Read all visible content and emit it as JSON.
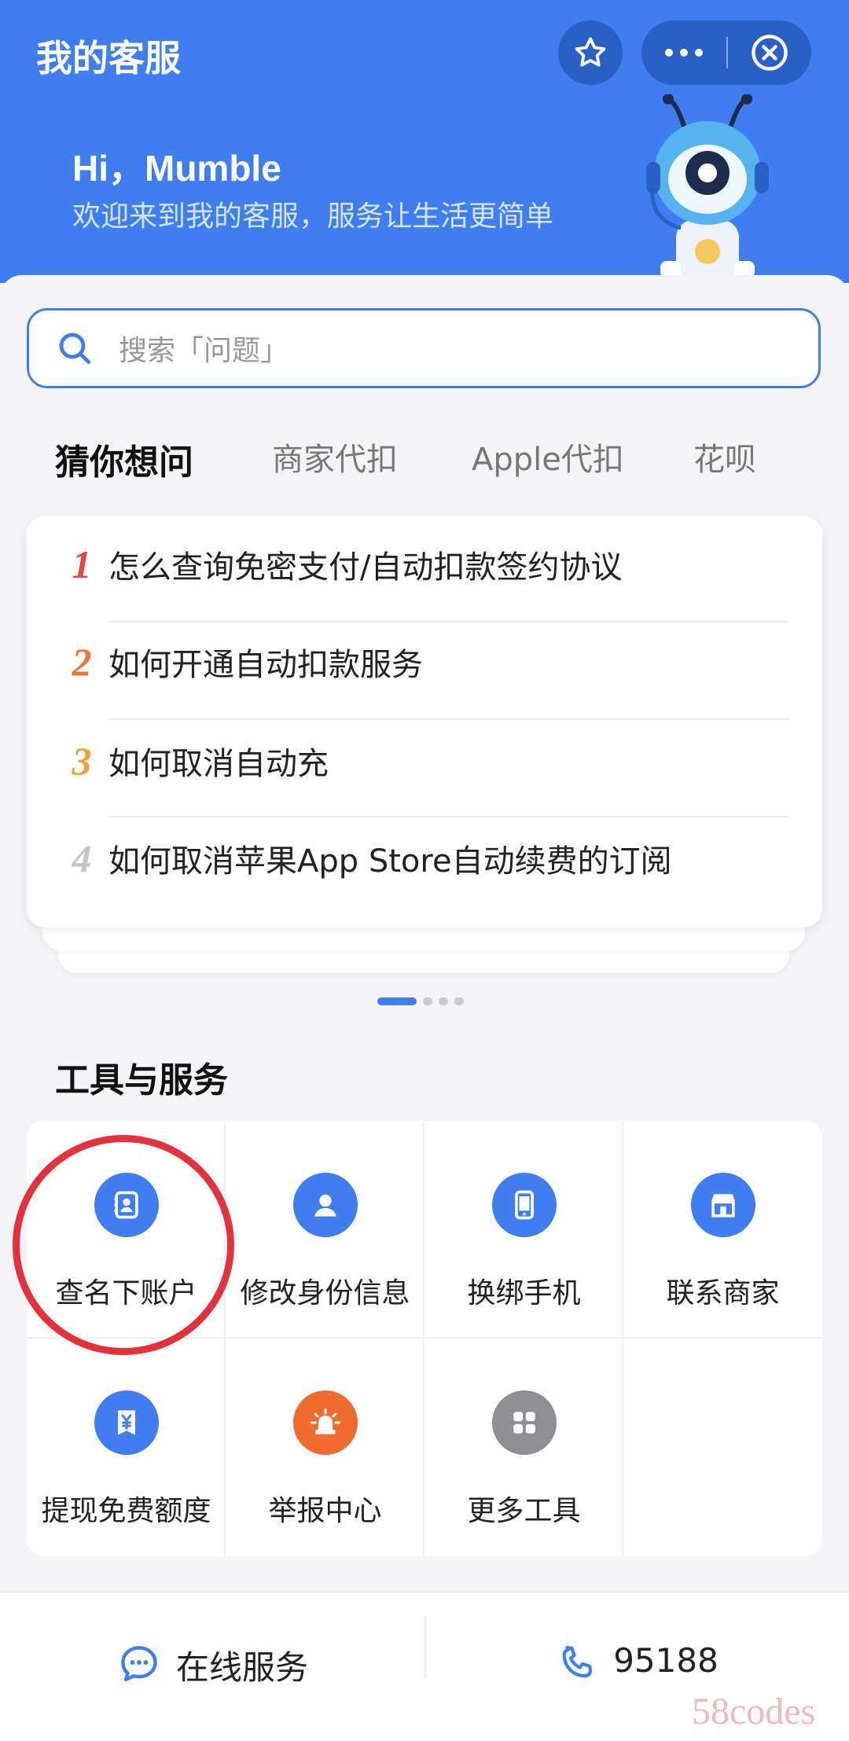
{
  "header": {
    "title": "我的客服",
    "greeting": "Hi，Mumble",
    "subtitle": "欢迎来到我的客服，服务让生活更简单"
  },
  "search": {
    "placeholder": "搜索「问题」"
  },
  "tabs": [
    {
      "label": "猜你想问",
      "active": true
    },
    {
      "label": "商家代扣",
      "active": false
    },
    {
      "label": "Apple代扣",
      "active": false
    },
    {
      "label": "花呗",
      "active": false
    }
  ],
  "questions": [
    {
      "num": "1",
      "text": "怎么查询免密支付/自动扣款签约协议",
      "color": "#e4483e"
    },
    {
      "num": "2",
      "text": "如何开通自动扣款服务",
      "color": "#f0733a"
    },
    {
      "num": "3",
      "text": "如何取消自动充",
      "color": "#f0a23a"
    },
    {
      "num": "4",
      "text": "如何取消苹果App Store自动续费的订阅",
      "color": "#c4c4c4"
    }
  ],
  "tools": {
    "title": "工具与服务",
    "items": [
      {
        "label": "查名下账户",
        "icon": "account-card-icon",
        "color": "#3f7ef1"
      },
      {
        "label": "修改身份信息",
        "icon": "person-icon",
        "color": "#3f7ef1"
      },
      {
        "label": "换绑手机",
        "icon": "phone-icon",
        "color": "#3f7ef1"
      },
      {
        "label": "联系商家",
        "icon": "store-icon",
        "color": "#3f7ef1"
      },
      {
        "label": "提现免费额度",
        "icon": "yuan-icon",
        "color": "#3f7ef1"
      },
      {
        "label": "举报中心",
        "icon": "alarm-icon",
        "color": "#f26b2e"
      },
      {
        "label": "更多工具",
        "icon": "grid-icon",
        "color": "#8e8e93"
      }
    ]
  },
  "bottom": {
    "online_service": "在线服务",
    "phone": "95188"
  },
  "watermark": "58codes",
  "colors": {
    "brand": "#3f7ef1",
    "highlight": "#e2323c"
  }
}
